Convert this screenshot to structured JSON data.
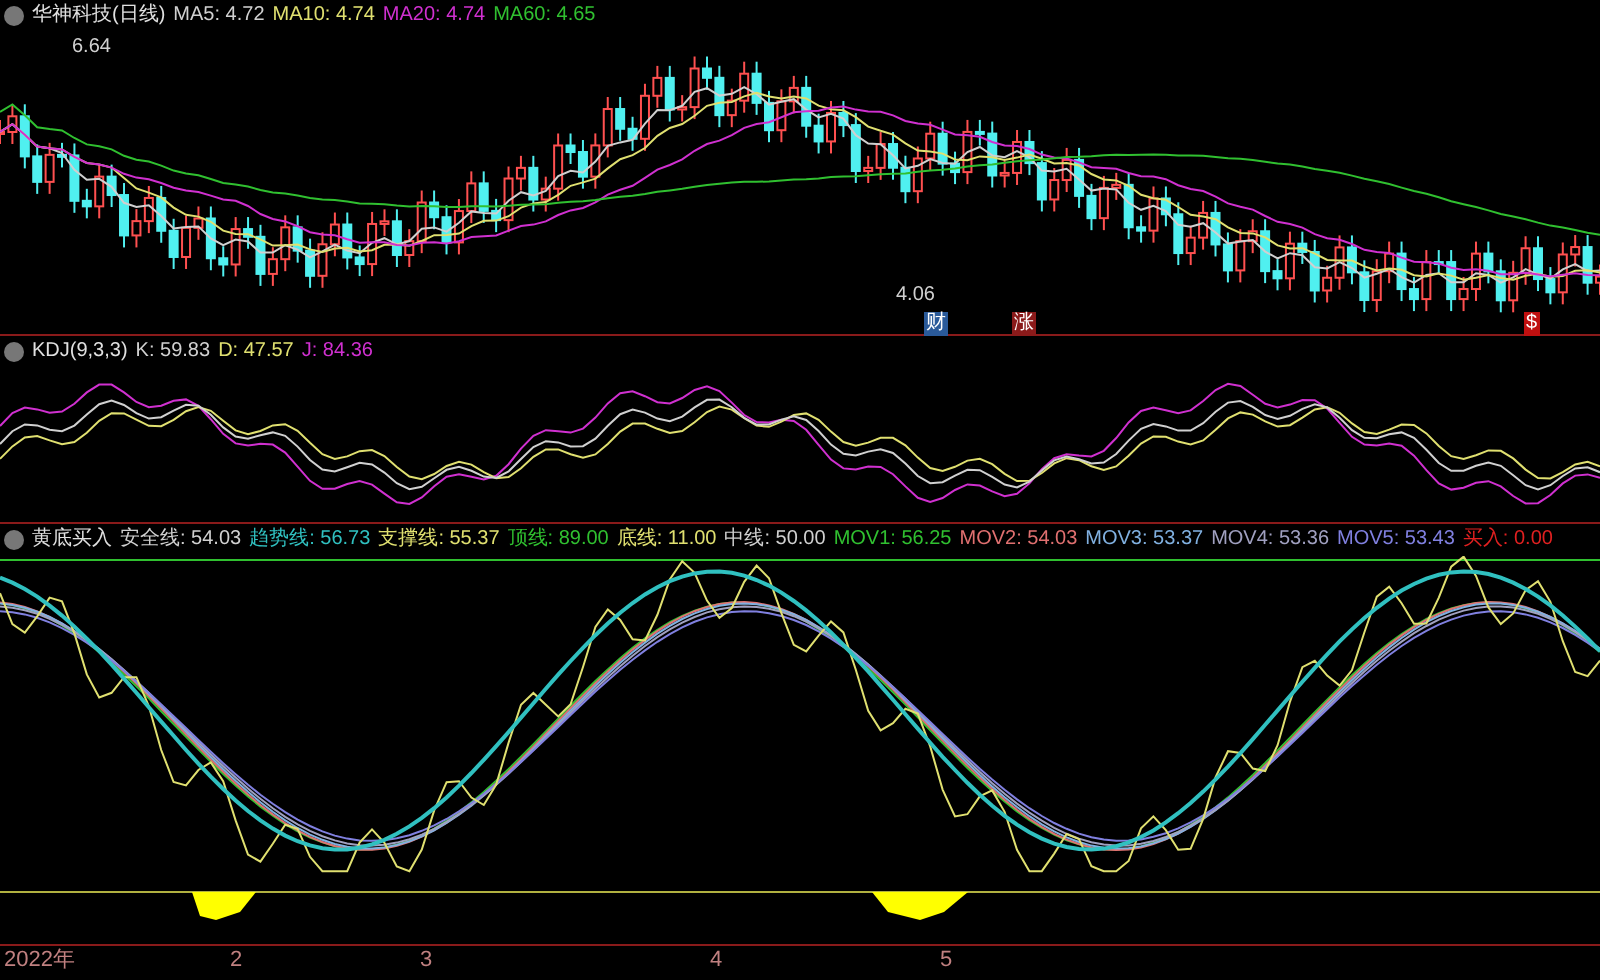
{
  "price_panel": {
    "title": "华神科技(日线)",
    "indicators": [
      {
        "label": "MA5: 4.72",
        "color": "#d0d0d0"
      },
      {
        "label": "MA10: 4.74",
        "color": "#e0e070"
      },
      {
        "label": "MA20: 4.74",
        "color": "#d030d0"
      },
      {
        "label": "MA60: 4.65",
        "color": "#30c030"
      }
    ],
    "high_label": "6.64",
    "low_label": "4.06",
    "markers": [
      {
        "text": "财",
        "color": "#2a5a9a"
      },
      {
        "text": "涨",
        "color": "#8a1a1a"
      },
      {
        "text": "$",
        "color": "#c01010"
      }
    ]
  },
  "kdj_panel": {
    "title": "KDJ(9,3,3)",
    "indicators": [
      {
        "label": "K: 59.83",
        "color": "#d0d0d0"
      },
      {
        "label": "D: 47.57",
        "color": "#e0e070"
      },
      {
        "label": "J: 84.36",
        "color": "#d030d0"
      }
    ]
  },
  "signal_panel": {
    "title": "黄底买入",
    "indicators": [
      {
        "label": "安全线: 54.03",
        "color": "#d0d0d0"
      },
      {
        "label": "趋势线: 56.73",
        "color": "#30c0c0"
      },
      {
        "label": "支撑线: 55.37",
        "color": "#e0e070"
      },
      {
        "label": "顶线: 89.00",
        "color": "#30c030"
      },
      {
        "label": "底线: 11.00",
        "color": "#e0e070"
      },
      {
        "label": "中线: 50.00",
        "color": "#d0d0d0"
      },
      {
        "label": "MOV1: 56.25",
        "color": "#30c030"
      },
      {
        "label": "MOV2: 54.03",
        "color": "#e07070"
      },
      {
        "label": "MOV3: 53.37",
        "color": "#80b0e0"
      },
      {
        "label": "MOV4: 53.36",
        "color": "#a0a0c0"
      },
      {
        "label": "MOV5: 53.43",
        "color": "#8080e0"
      },
      {
        "label": "买入: 0.00",
        "color": "#e02020"
      }
    ]
  },
  "time_axis": {
    "labels": [
      "2022年",
      "2",
      "3",
      "4",
      "5"
    ]
  }
}
